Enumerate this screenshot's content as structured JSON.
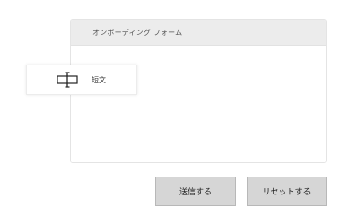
{
  "form": {
    "title": "オンボーディング フォーム"
  },
  "palette_item": {
    "icon": "text-input-icon",
    "label": "短文"
  },
  "buttons": {
    "submit_label": "送信する",
    "reset_label": "リセットする"
  },
  "colors": {
    "header_background": "#ececec",
    "button_background": "#d6d6d6",
    "panel_border": "#e4e4e4"
  }
}
